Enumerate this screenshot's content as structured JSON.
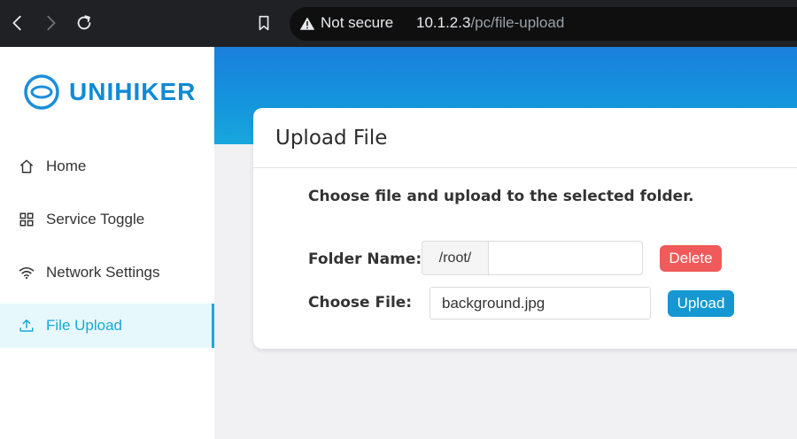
{
  "browser": {
    "security_label": "Not secure",
    "url_host": "10.1.2.3",
    "url_path": "/pc/file-upload",
    "icons": [
      "back-icon",
      "forward-icon",
      "reload-icon",
      "bookmark-icon",
      "warning-icon"
    ]
  },
  "sidebar": {
    "logo_text": "UNIHIKER",
    "items": [
      {
        "label": "Home",
        "icon": "home-icon"
      },
      {
        "label": "Service Toggle",
        "icon": "grid-icon"
      },
      {
        "label": "Network Settings",
        "icon": "wifi-icon"
      },
      {
        "label": "File Upload",
        "icon": "upload-icon",
        "active": true
      }
    ]
  },
  "upload": {
    "title": "Upload File",
    "description": "Choose file and upload to the selected folder.",
    "folder_label": "Folder Name:",
    "folder_prefix": "/root/",
    "folder_value": "",
    "file_label": "Choose File:",
    "file_value": "background.jpg",
    "delete_label": "Delete",
    "upload_label": "Upload"
  },
  "colors": {
    "accent": "#17a9d9",
    "delete": "#f05a5a",
    "upload": "#1598d2",
    "banner": "#1a7fdc"
  }
}
